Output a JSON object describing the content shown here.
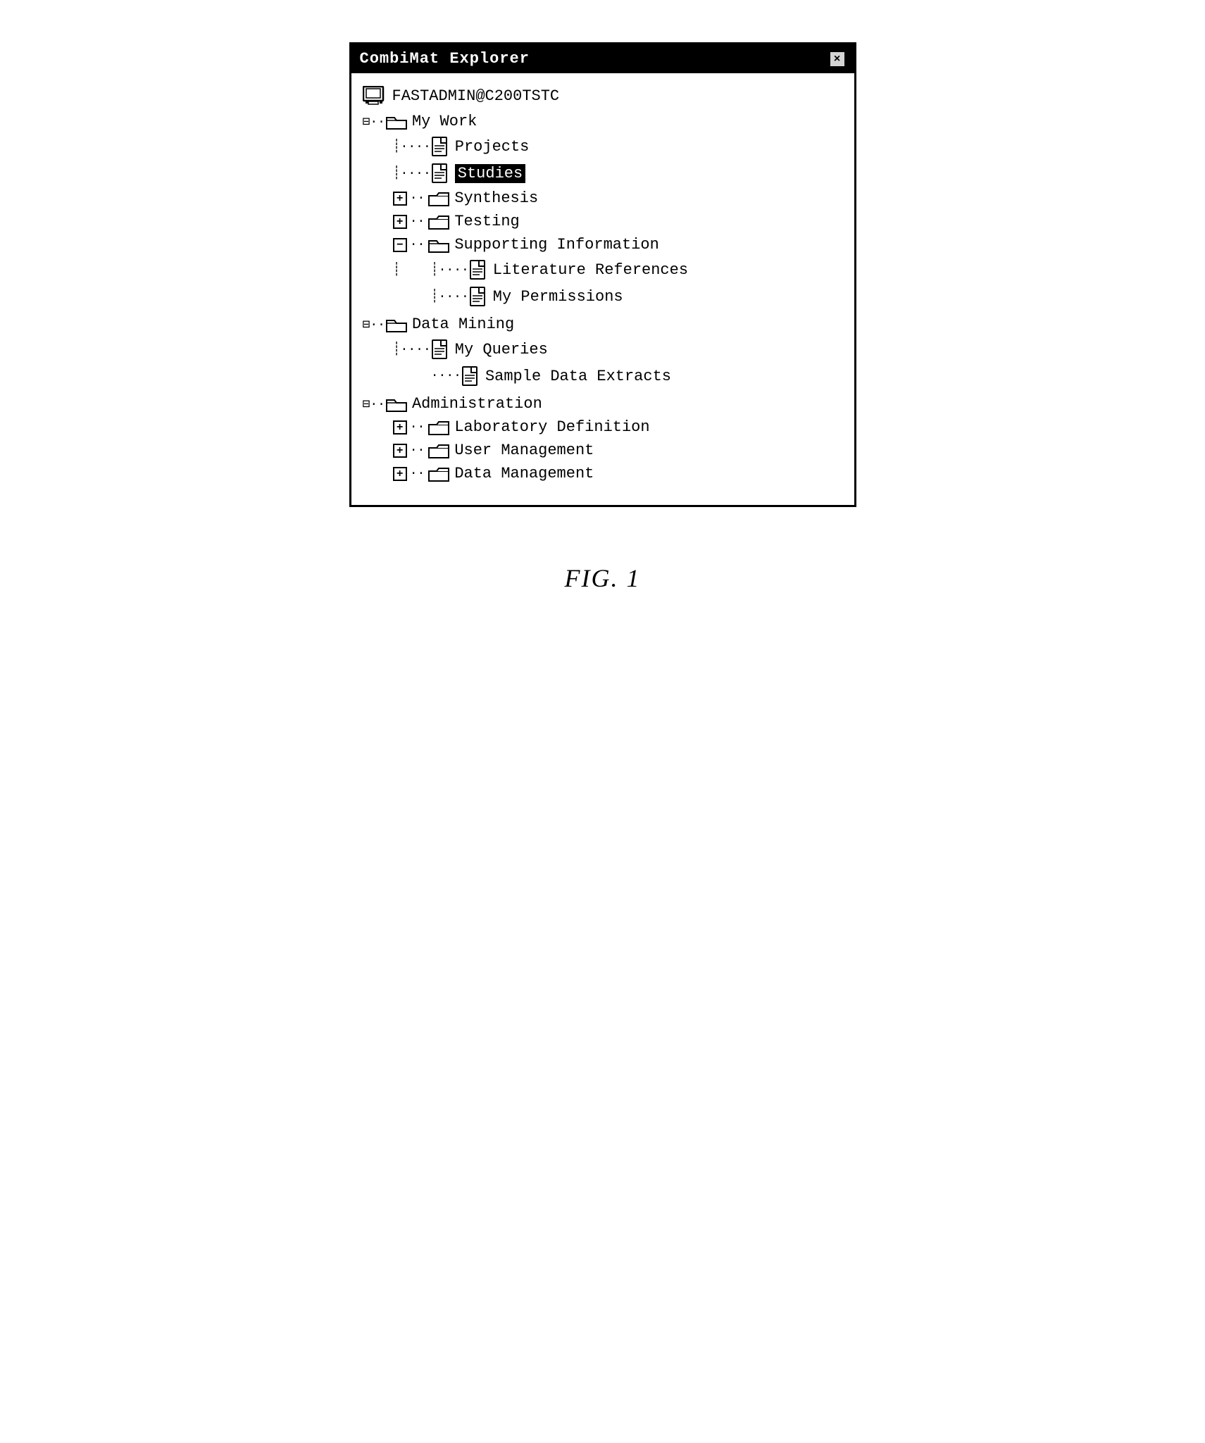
{
  "window": {
    "title": "CombiMat Explorer",
    "close_button": "×"
  },
  "root": {
    "label": "FASTADMIN@C200TSTC"
  },
  "tree": {
    "my_work": {
      "label": "My Work",
      "children": {
        "projects": {
          "label": "Projects"
        },
        "studies": {
          "label": "Studies",
          "selected": true
        },
        "synthesis": {
          "label": "Synthesis"
        },
        "testing": {
          "label": "Testing"
        },
        "supporting_info": {
          "label": "Supporting Information",
          "children": {
            "lit_refs": {
              "label": "Literature References"
            },
            "my_perms": {
              "label": "My Permissions"
            }
          }
        }
      }
    },
    "data_mining": {
      "label": "Data Mining",
      "children": {
        "my_queries": {
          "label": "My Queries"
        },
        "sample_extracts": {
          "label": "Sample Data Extracts"
        }
      }
    },
    "administration": {
      "label": "Administration",
      "children": {
        "lab_def": {
          "label": "Laboratory Definition"
        },
        "user_mgmt": {
          "label": "User Management"
        },
        "data_mgmt": {
          "label": "Data Management"
        }
      }
    }
  },
  "figure": {
    "caption": "FIG. 1"
  },
  "icons": {
    "minus": "−",
    "plus": "+",
    "close": "×"
  }
}
